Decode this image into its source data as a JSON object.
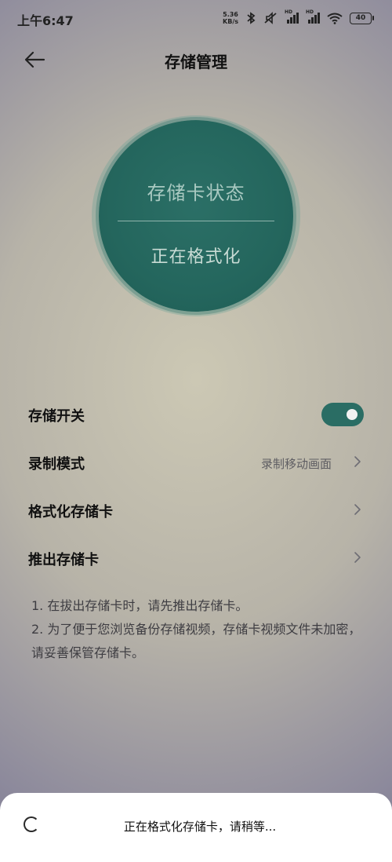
{
  "status_bar": {
    "time": "上午6:47",
    "net_speed_value": "5.36",
    "net_speed_unit": "KB/s",
    "battery": "40",
    "icons": [
      "bluetooth-icon",
      "mute-icon",
      "signal-hd-icon",
      "signal-hd-icon",
      "wifi-icon",
      "battery-icon"
    ]
  },
  "header": {
    "title": "存储管理",
    "back_icon": "back-arrow-icon"
  },
  "status_circle": {
    "title": "存储卡状态",
    "status": "正在格式化"
  },
  "settings": {
    "storage_switch": {
      "label": "存储开关",
      "on": true
    },
    "record_mode": {
      "label": "录制模式",
      "value": "录制移动画面"
    },
    "format_card": {
      "label": "格式化存储卡"
    },
    "eject_card": {
      "label": "推出存储卡"
    }
  },
  "notes": {
    "line1": "1. 在拔出存储卡时，请先推出存储卡。",
    "line2": "2. 为了便于您浏览备份存储视频，存储卡视频文件未加密，请妥善保管存储卡。"
  },
  "toast": {
    "message": "正在格式化存储卡，请稍等..."
  },
  "colors": {
    "accent": "#2a6d64",
    "circle_text": "#a9c9c1",
    "toast_bg": "#ffffff"
  }
}
